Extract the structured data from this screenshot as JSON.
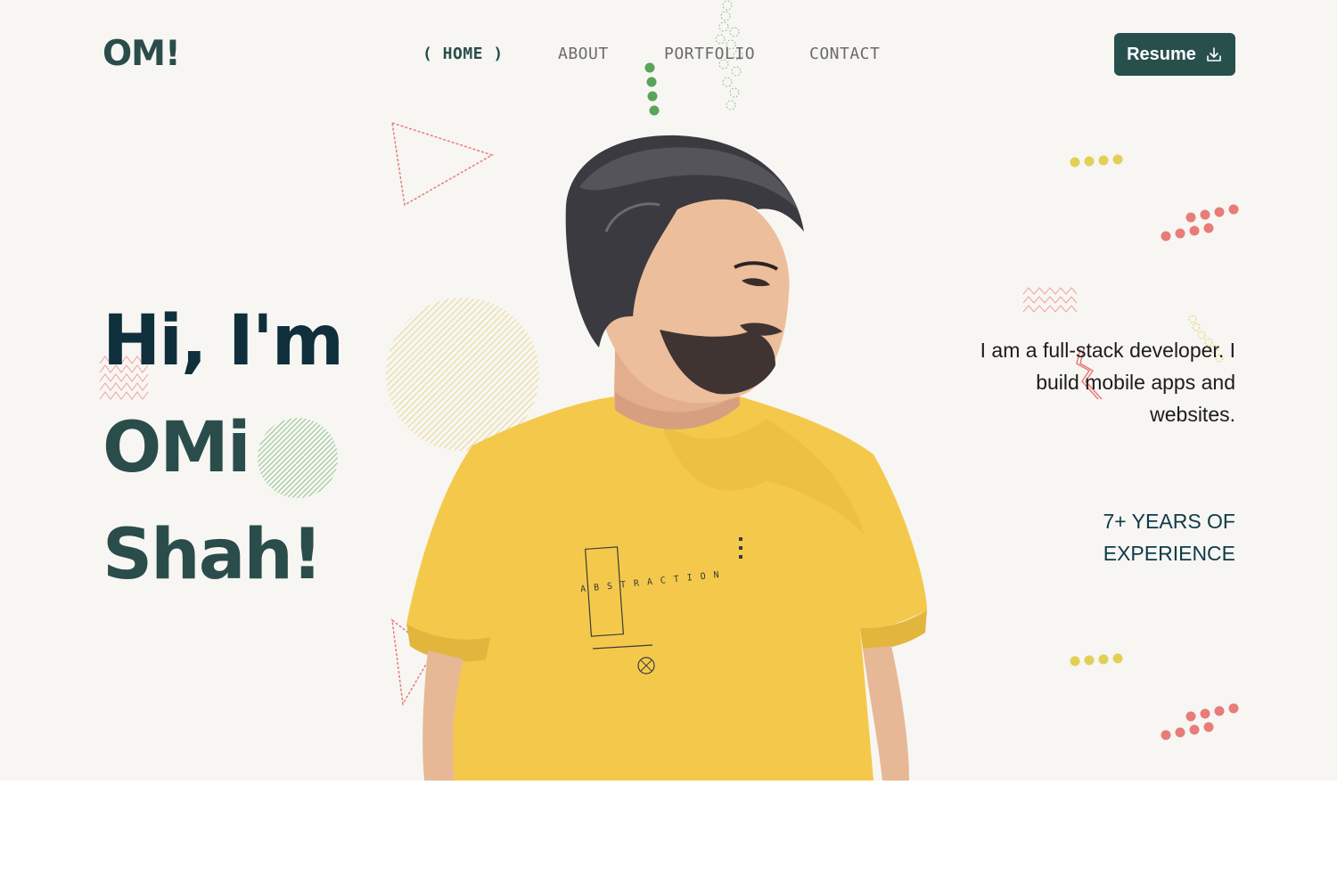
{
  "header": {
    "logo": "OM!",
    "nav": [
      {
        "label": "( HOME )",
        "active": true
      },
      {
        "label": "ABOUT",
        "active": false
      },
      {
        "label": "PORTFOLIO",
        "active": false
      },
      {
        "label": "CONTACT",
        "active": false
      }
    ],
    "resume_label": "Resume",
    "resume_icon": "download-icon"
  },
  "hero": {
    "greeting_lines": [
      "Hi, I'm",
      "OMi",
      "Shah!"
    ],
    "intro": "I am a full-stack developer. I build mobile apps and websites.",
    "experience": "7+ YEARS OF EXPERIENCE",
    "shirt_print": "ABSTRACTION"
  },
  "colors": {
    "background": "#f7f6f2",
    "primary": "#27504d",
    "heading_dark": "#0f2f3d",
    "accent_green": "#5aa35a",
    "accent_yellow": "#e3cf55",
    "accent_red": "#e77c7a",
    "shirt": "#f4c94b"
  }
}
